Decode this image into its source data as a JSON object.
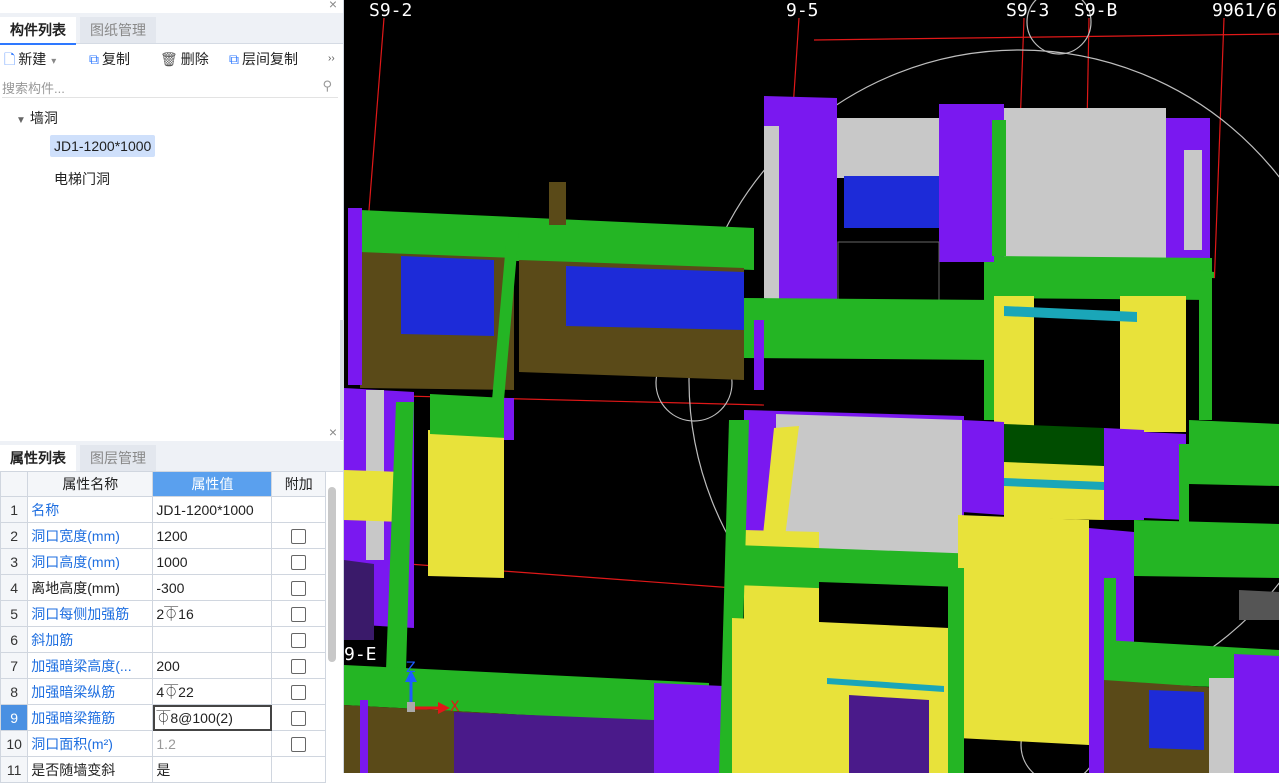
{
  "top_panel": {
    "tabs": [
      "构件列表",
      "图纸管理"
    ],
    "close": "×",
    "toolbar": {
      "new_label": "新建",
      "copy_label": "复制",
      "delete_label": "删除",
      "floor_copy_label": "层间复制",
      "more": "››"
    },
    "search_placeholder": "搜索构件...",
    "tree": {
      "group": "墙洞",
      "items": [
        "JD1-1200*1000",
        "电梯门洞"
      ]
    }
  },
  "bottom_panel": {
    "tabs": [
      "属性列表",
      "图层管理"
    ],
    "close": "×",
    "headers": [
      "属性名称",
      "属性值",
      "附加"
    ],
    "rows": [
      {
        "n": "1",
        "name": "名称",
        "value": "JD1-1200*1000",
        "check": false
      },
      {
        "n": "2",
        "name": "洞口宽度(mm)",
        "value": "1200",
        "check": true
      },
      {
        "n": "3",
        "name": "洞口高度(mm)",
        "value": "1000",
        "check": true
      },
      {
        "n": "4",
        "name": "离地高度(mm)",
        "value": "-300",
        "check": true
      },
      {
        "n": "5",
        "name": "洞口每侧加强筋",
        "value": "2⏁16",
        "check": true
      },
      {
        "n": "6",
        "name": "斜加筋",
        "value": "",
        "check": true
      },
      {
        "n": "7",
        "name": "加强暗梁高度(...",
        "value": "200",
        "check": true
      },
      {
        "n": "8",
        "name": "加强暗梁纵筋",
        "value": "4⏁22",
        "check": true
      },
      {
        "n": "9",
        "name": "加强暗梁箍筋",
        "value": "⏁8@100(2)",
        "check": true
      },
      {
        "n": "10",
        "name": "洞口面积(m²)",
        "value": "1.2",
        "check": true
      },
      {
        "n": "11",
        "name": "是否随墙变斜",
        "value": "是",
        "check": false
      }
    ]
  },
  "viewport": {
    "axis_labels": [
      "S9-2",
      "9-5",
      "S9-3",
      "S9-B",
      "9961/6",
      "9-E"
    ],
    "axis_gizmo": {
      "x": "X",
      "z": "Z"
    }
  },
  "colors": {
    "accent": "#2e78ff",
    "purple": "#7a18f0",
    "green": "#24b524",
    "olive": "#5a4a18",
    "yellow": "#e8e23a",
    "blue": "#1d2bd8",
    "gray": "#c8c8c8",
    "grid_red": "#e01818"
  }
}
